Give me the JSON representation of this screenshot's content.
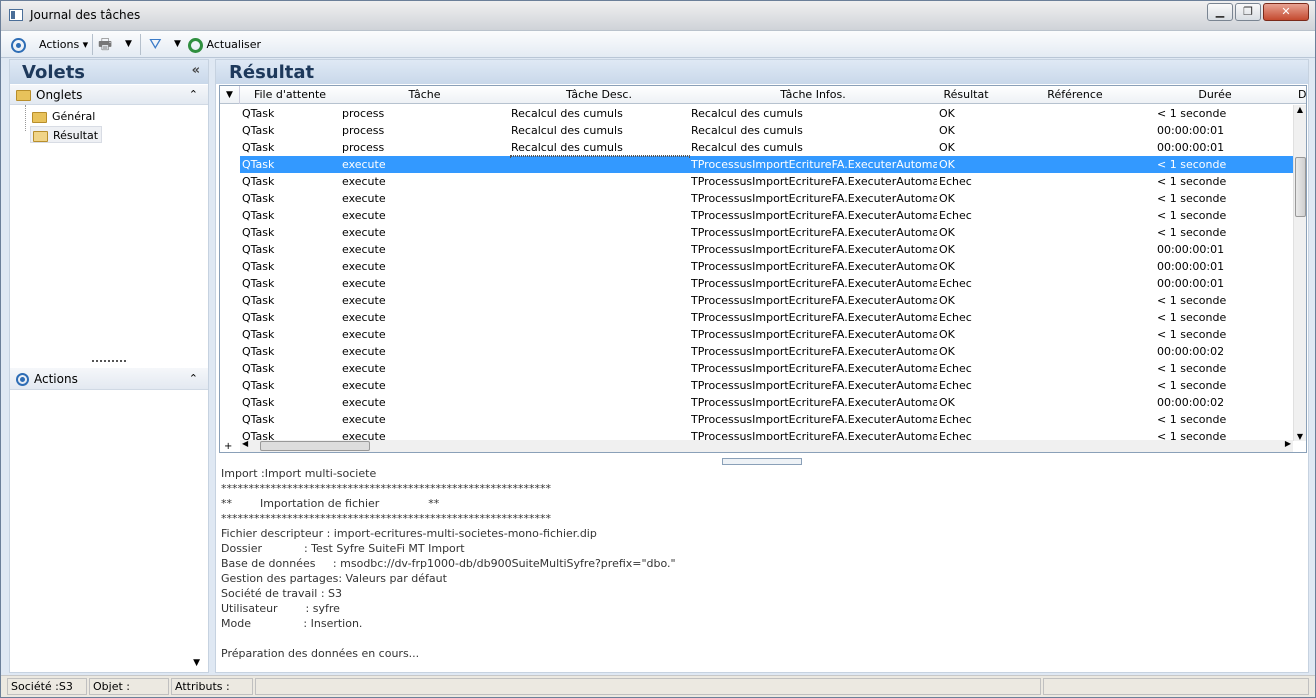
{
  "window": {
    "title": "Journal des tâches",
    "minimize": "▁",
    "maximize": "❐",
    "close": "✕"
  },
  "toolbar": {
    "actions_label": "Actions",
    "refresh_label": "Actualiser"
  },
  "left_panel": {
    "title": "Volets",
    "collapse": "«",
    "tabs_group": "Onglets",
    "tree": [
      "Général",
      "Résultat"
    ],
    "actions_group": "Actions"
  },
  "result": {
    "title": "Résultat",
    "columns": [
      "File d'attente",
      "Tâche",
      "Tâche Desc.",
      "Tâche Infos.",
      "Résultat",
      "Référence",
      "Durée",
      "D"
    ],
    "rows": [
      [
        "QTask",
        "process",
        "Recalcul des cumuls",
        "Recalcul des cumuls",
        "OK",
        "",
        "< 1 seconde"
      ],
      [
        "QTask",
        "process",
        "Recalcul des cumuls",
        "Recalcul des cumuls",
        "OK",
        "",
        "00:00:00:01"
      ],
      [
        "QTask",
        "process",
        "Recalcul des cumuls",
        "Recalcul des cumuls",
        "OK",
        "",
        "00:00:00:01"
      ],
      [
        "QTask",
        "execute",
        "",
        "TProcessusImportEcritureFA.ExecuterAutomat",
        "OK",
        "",
        "< 1 seconde"
      ],
      [
        "QTask",
        "execute",
        "",
        "TProcessusImportEcritureFA.ExecuterAutomat",
        "Echec",
        "",
        "< 1 seconde"
      ],
      [
        "QTask",
        "execute",
        "",
        "TProcessusImportEcritureFA.ExecuterAutomat",
        "OK",
        "",
        "< 1 seconde"
      ],
      [
        "QTask",
        "execute",
        "",
        "TProcessusImportEcritureFA.ExecuterAutomat",
        "Echec",
        "",
        "< 1 seconde"
      ],
      [
        "QTask",
        "execute",
        "",
        "TProcessusImportEcritureFA.ExecuterAutomat",
        "OK",
        "",
        "< 1 seconde"
      ],
      [
        "QTask",
        "execute",
        "",
        "TProcessusImportEcritureFA.ExecuterAutomat",
        "OK",
        "",
        "00:00:00:01"
      ],
      [
        "QTask",
        "execute",
        "",
        "TProcessusImportEcritureFA.ExecuterAutomat",
        "OK",
        "",
        "00:00:00:01"
      ],
      [
        "QTask",
        "execute",
        "",
        "TProcessusImportEcritureFA.ExecuterAutomat",
        "Echec",
        "",
        "00:00:00:01"
      ],
      [
        "QTask",
        "execute",
        "",
        "TProcessusImportEcritureFA.ExecuterAutomat",
        "OK",
        "",
        "< 1 seconde"
      ],
      [
        "QTask",
        "execute",
        "",
        "TProcessusImportEcritureFA.ExecuterAutomat",
        "Echec",
        "",
        "< 1 seconde"
      ],
      [
        "QTask",
        "execute",
        "",
        "TProcessusImportEcritureFA.ExecuterAutomat",
        "OK",
        "",
        "< 1 seconde"
      ],
      [
        "QTask",
        "execute",
        "",
        "TProcessusImportEcritureFA.ExecuterAutomat",
        "OK",
        "",
        "00:00:00:02"
      ],
      [
        "QTask",
        "execute",
        "",
        "TProcessusImportEcritureFA.ExecuterAutomat",
        "Echec",
        "",
        "< 1 seconde"
      ],
      [
        "QTask",
        "execute",
        "",
        "TProcessusImportEcritureFA.ExecuterAutomat",
        "Echec",
        "",
        "< 1 seconde"
      ],
      [
        "QTask",
        "execute",
        "",
        "TProcessusImportEcritureFA.ExecuterAutomat",
        "OK",
        "",
        "00:00:00:02"
      ],
      [
        "QTask",
        "execute",
        "",
        "TProcessusImportEcritureFA.ExecuterAutomat",
        "Echec",
        "",
        "< 1 seconde"
      ],
      [
        "QTask",
        "execute",
        "",
        "TProcessusImportEcritureFA.ExecuterAutomat",
        "Echec",
        "",
        "< 1 seconde"
      ]
    ],
    "selected_row": 3
  },
  "log": [
    "Import :Import multi-societe",
    "************************************************************",
    "**        Importation de fichier              **",
    "************************************************************",
    "Fichier descripteur : import-ecritures-multi-societes-mono-fichier.dip",
    "Dossier            : Test Syfre SuiteFi MT Import",
    "Base de données     : msodbc://dv-frp1000-db/db900SuiteMultiSyfre?prefix=\"dbo.\"",
    "Gestion des partages: Valeurs par défaut",
    "Société de travail : S3",
    "Utilisateur        : syfre",
    "Mode               : Insertion.",
    "",
    "Préparation des données en cours..."
  ],
  "status": {
    "societe": "Société :S3",
    "objet": "Objet :",
    "attributs": "Attributs :"
  }
}
